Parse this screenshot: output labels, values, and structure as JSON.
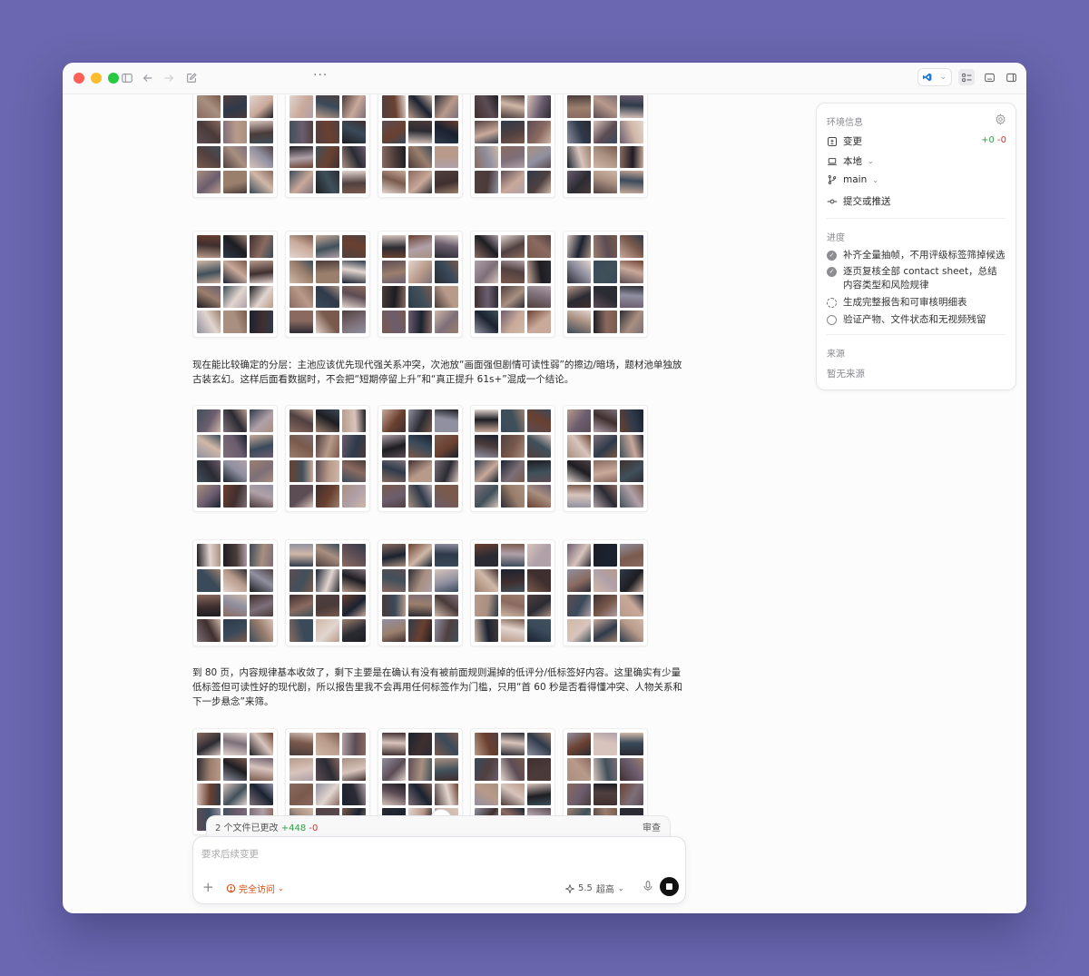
{
  "toolbar": {
    "more_label": "···"
  },
  "content": {
    "paragraph_1": "现在能比较确定的分层：主池应该优先现代强关系冲突，次池放“画面强但剧情可读性弱”的擦边/暗场，题材池单独放古装玄幻。这样后面看数据时，不会把“短期停留上升”和“真正提升 61s+”混成一个结论。",
    "paragraph_2": "到 80 页，内容规律基本收敛了，剩下主要是在确认有没有被前面规则漏掉的低评分/低标签好内容。这里确实有少量低标签但可读性好的现代剧，所以报告里我不会再用任何标签作为门槛，只用“首 60 秒是否看得懂冲突、人物关系和下一步悬念”来筛。",
    "palette": [
      "#2b2b33",
      "#4a3b3a",
      "#7a5a4c",
      "#b89a8a",
      "#d8c4bc",
      "#3a4a5a",
      "#1d1d22",
      "#6b5d6e",
      "#9b7f6d",
      "#c9a99a",
      "#504040",
      "#8a6a60",
      "#2f3a4a",
      "#a88f80",
      "#e2d5cf",
      "#5c4c54",
      "#7d6f78",
      "#3f2f2f",
      "#b0a0a8",
      "#1a2230",
      "#6a4030",
      "#d0b8a8",
      "#40505a",
      "#9090a0"
    ],
    "sheet_rows": 6,
    "sheets_per_row": 5,
    "cells_per_sheet": 12
  },
  "changes_bar": {
    "files_label": "2 个文件已更改",
    "added": "+448",
    "removed": "-0",
    "review_label": "审查"
  },
  "composer": {
    "placeholder": "要求后续变更",
    "add_label": "+",
    "access_label": "完全访问",
    "model_version": "5.5",
    "model_level": "超高"
  },
  "panel": {
    "env_title": "环境信息",
    "changes_label": "变更",
    "diff_added": "+0",
    "diff_removed": "-0",
    "local_label": "本地",
    "branch_label": "main",
    "commit_label": "提交或推送",
    "progress_title": "进度",
    "tasks": [
      {
        "label": "补齐全量抽帧，不用评级标签筛掉候选",
        "status": "done"
      },
      {
        "label": "逐页复核全部 contact sheet，总结内容类型和风险规律",
        "status": "done"
      },
      {
        "label": "生成完整报告和可审核明细表",
        "status": "in-progress"
      },
      {
        "label": "验证产物、文件状态和无视频残留",
        "status": "todo"
      }
    ],
    "source_title": "来源",
    "source_empty": "暂无来源"
  }
}
